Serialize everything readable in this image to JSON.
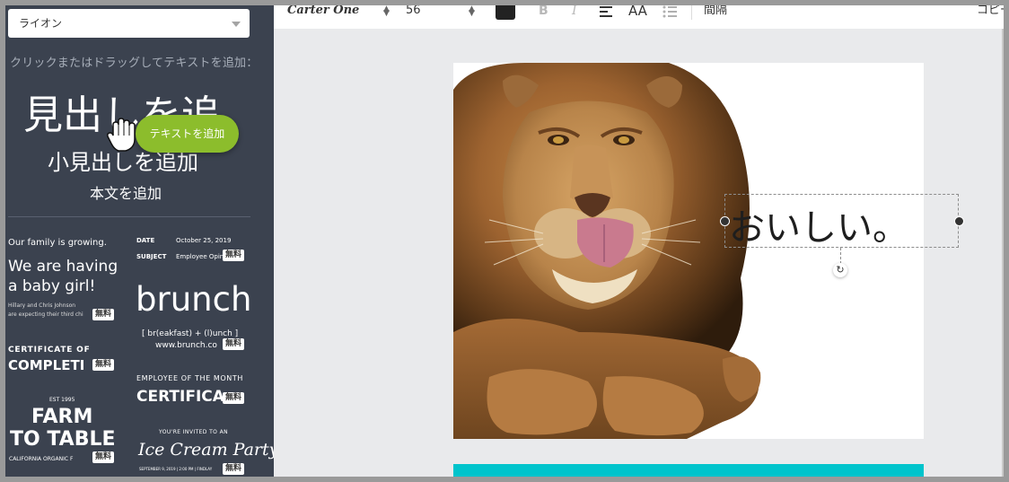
{
  "sidebar": {
    "search_value": "ライオン",
    "hint": "クリックまたはドラッグしてテキストを追加：",
    "heading": "見出しを追",
    "subheading": "小見出しを追加",
    "body": "本文を追加",
    "drag_pill": "テキストを追加",
    "templates": {
      "family": {
        "line1": "Our family is growing.",
        "line2": "We are having",
        "line3": "a baby girl!",
        "line4": "Hillary and Chris Johnson",
        "line5": "are expecting their third chi"
      },
      "memo": {
        "date_label": "DATE",
        "date_value": "October 25, 2019",
        "subject_label": "SUBJECT",
        "subject_value": "Employee Opinio"
      },
      "brunch": {
        "title": "brunch",
        "line1": "[ br(eakfast) + (l)unch ]",
        "line2": "www.brunch.co"
      },
      "completion": {
        "line1": "CERTIFICATE OF",
        "line2": "COMPLETI"
      },
      "employee": {
        "line1": "EMPLOYEE OF THE MONTH",
        "line2": "CERTIFICA"
      },
      "farm": {
        "est": "EST 1995",
        "line1": "FARM",
        "line2": "TO TABLE",
        "line3": "CALIFORNIA ORGANIC F"
      },
      "icecream": {
        "line1": "YOU'RE INVITED TO AN",
        "line2": "Ice Cream Party",
        "line3": "SEPTEMBER 9, 2019 | 2:00 PM | FINDLAY"
      },
      "badge": "無料"
    }
  },
  "toolbar": {
    "font": "Carter One",
    "size": "56",
    "spacing_label": "間隔",
    "copy_label": "コピー",
    "aa_label": "AA",
    "bold_label": "B",
    "italic_label": "I"
  },
  "canvas": {
    "text": "おいしい。",
    "page2_color": "#00c4cc"
  }
}
